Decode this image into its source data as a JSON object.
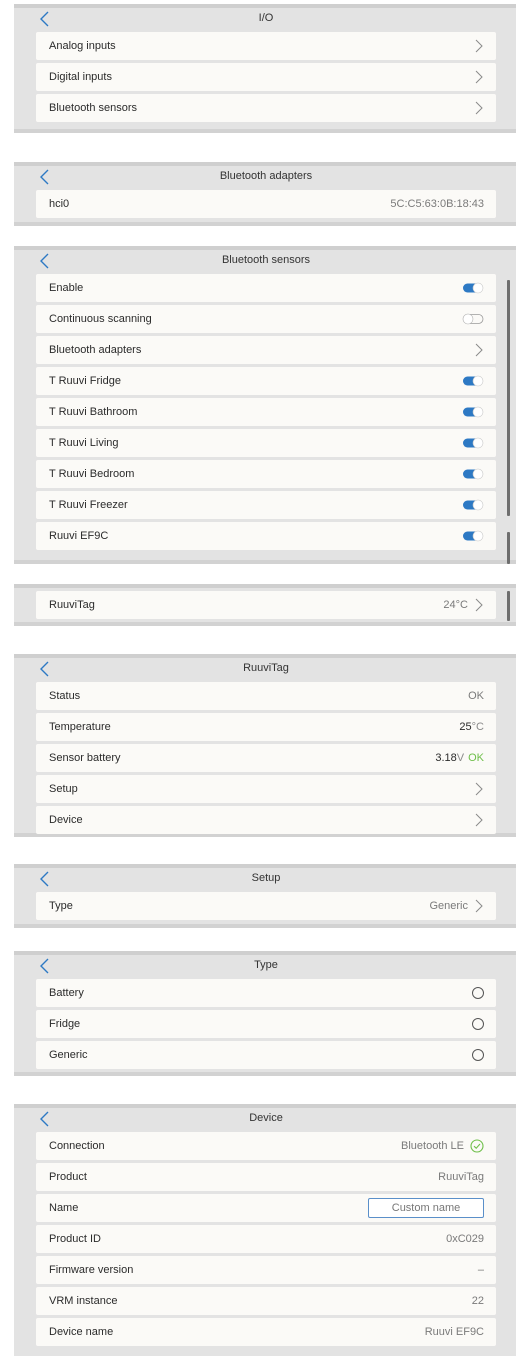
{
  "colors": {
    "accent": "#2d79c4",
    "ok": "#6fbf4a",
    "panel": "#e3e3e3",
    "row": "#fbfaf7"
  },
  "io": {
    "title": "I/O",
    "items": [
      {
        "label": "Analog inputs",
        "icon": "chevron-right-icon"
      },
      {
        "label": "Digital inputs",
        "icon": "chevron-right-icon"
      },
      {
        "label": "Bluetooth sensors",
        "icon": "chevron-right-icon"
      }
    ]
  },
  "adapters": {
    "title": "Bluetooth adapters",
    "items": [
      {
        "label": "hci0",
        "value": "5C:C5:63:0B:18:43"
      }
    ]
  },
  "sensors": {
    "title": "Bluetooth sensors",
    "items": [
      {
        "label": "Enable",
        "type": "toggle",
        "on": true
      },
      {
        "label": "Continuous scanning",
        "type": "toggle",
        "on": false
      },
      {
        "label": "Bluetooth adapters",
        "type": "chevron"
      },
      {
        "label": "T Ruuvi Fridge",
        "type": "toggle",
        "on": true
      },
      {
        "label": "T Ruuvi Bathroom",
        "type": "toggle",
        "on": true
      },
      {
        "label": "T Ruuvi Living",
        "type": "toggle",
        "on": true
      },
      {
        "label": "T Ruuvi Bedroom",
        "type": "toggle",
        "on": true
      },
      {
        "label": "T Ruuvi Freezer",
        "type": "toggle",
        "on": true
      },
      {
        "label": "Ruuvi EF9C",
        "type": "toggle",
        "on": true
      }
    ]
  },
  "ruuvitag_list": {
    "label": "RuuviTag",
    "value": "24°C"
  },
  "ruuvitag": {
    "title": "RuuviTag",
    "status_label": "Status",
    "status_value": "OK",
    "temp_label": "Temperature",
    "temp_value": "25",
    "temp_unit": "°C",
    "battery_label": "Sensor battery",
    "battery_value": "3.18",
    "battery_unit": "V",
    "battery_status": "OK",
    "setup_label": "Setup",
    "device_label": "Device"
  },
  "setup": {
    "title": "Setup",
    "type_label": "Type",
    "type_value": "Generic"
  },
  "type": {
    "title": "Type",
    "options": [
      {
        "label": "Battery"
      },
      {
        "label": "Fridge"
      },
      {
        "label": "Generic"
      }
    ]
  },
  "device": {
    "title": "Device",
    "connection_label": "Connection",
    "connection_value": "Bluetooth LE",
    "product_label": "Product",
    "product_value": "RuuviTag",
    "name_label": "Name",
    "name_placeholder": "Custom name",
    "product_id_label": "Product ID",
    "product_id_value": "0xC029",
    "firmware_label": "Firmware version",
    "firmware_value": "–",
    "vrm_label": "VRM instance",
    "vrm_value": "22",
    "device_name_label": "Device name",
    "device_name_value": "Ruuvi EF9C"
  }
}
